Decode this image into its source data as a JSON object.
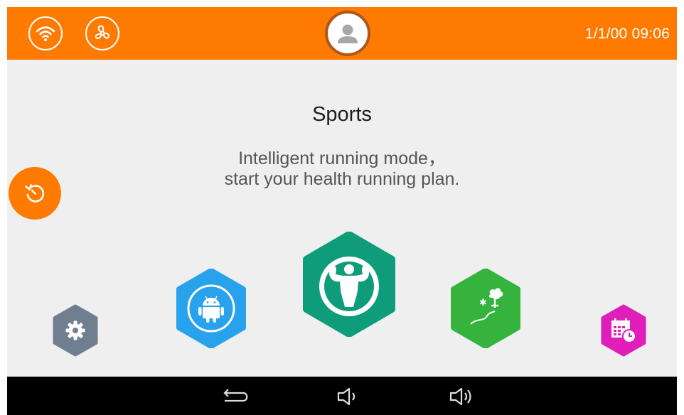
{
  "status_bar": {
    "wifi_icon": "wifi-icon",
    "fan_icon": "fan-icon",
    "avatar_icon": "user-avatar-icon",
    "datetime": "1/1/00 09:06"
  },
  "main": {
    "title": "Sports",
    "description_line1": "Intelligent running mode，",
    "description_line2": "start your health running plan.",
    "history_icon": "history-icon"
  },
  "apps": [
    {
      "id": "settings",
      "icon": "gear-icon",
      "color": "#6f7f8f"
    },
    {
      "id": "android",
      "icon": "android-icon",
      "color": "#29a2ee"
    },
    {
      "id": "sports",
      "icon": "bodybuilder-icon",
      "color": "#0f9c7b",
      "selected": true
    },
    {
      "id": "outdoor",
      "icon": "outdoor-trail-icon",
      "color": "#35b33c"
    },
    {
      "id": "calendar",
      "icon": "calendar-clock-icon",
      "color": "#e01fba"
    }
  ],
  "nav_bar": {
    "back_icon": "back-arrow-icon",
    "volume_down_icon": "volume-down-icon",
    "volume_up_icon": "volume-up-icon"
  },
  "colors": {
    "accent": "#ff7a00",
    "background": "#efefef",
    "nav_background": "#000000"
  }
}
